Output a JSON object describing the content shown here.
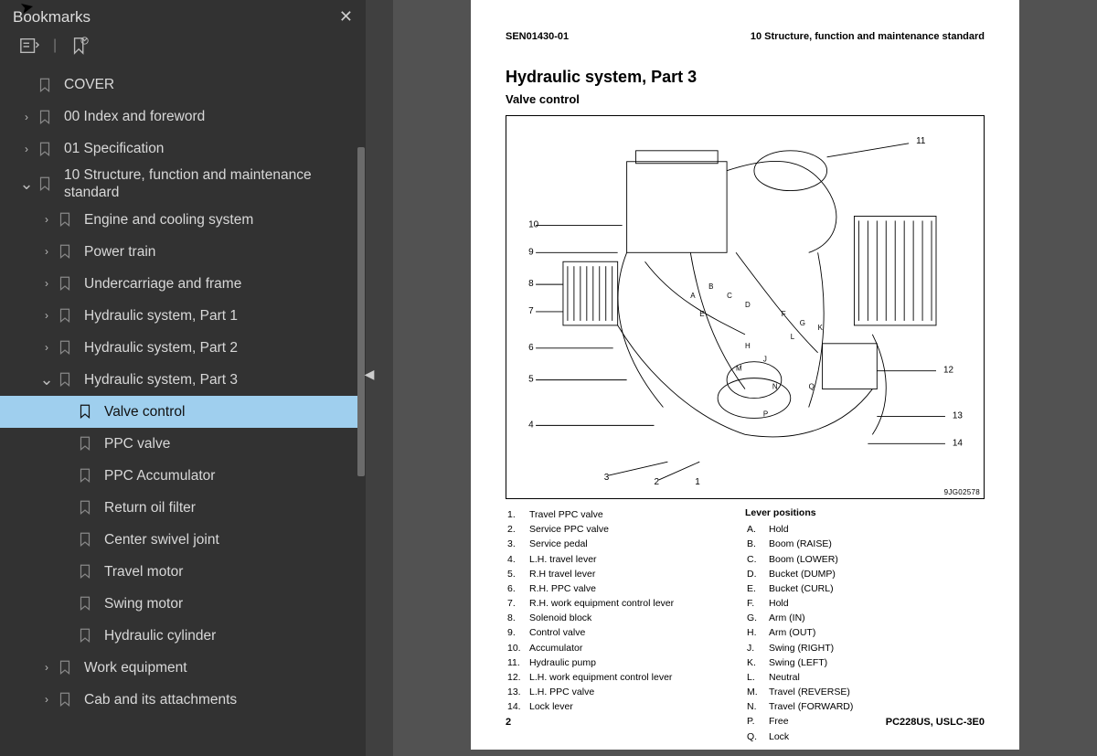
{
  "sidebar": {
    "title": "Bookmarks"
  },
  "tree": [
    {
      "label": "COVER",
      "expand": "",
      "depth": 0
    },
    {
      "label": "00 Index and foreword",
      "expand": ">",
      "depth": 0
    },
    {
      "label": "01 Specification",
      "expand": ">",
      "depth": 0
    },
    {
      "label": "10 Structure, function and maintenance standard",
      "expand": "v",
      "depth": 0
    },
    {
      "label": "Engine and cooling system",
      "expand": ">",
      "depth": 1
    },
    {
      "label": "Power train",
      "expand": ">",
      "depth": 1
    },
    {
      "label": "Undercarriage and frame",
      "expand": ">",
      "depth": 1
    },
    {
      "label": "Hydraulic system, Part 1",
      "expand": ">",
      "depth": 1
    },
    {
      "label": "Hydraulic system, Part 2",
      "expand": ">",
      "depth": 1
    },
    {
      "label": "Hydraulic system, Part 3",
      "expand": "v",
      "depth": 1
    },
    {
      "label": "Valve control",
      "expand": "",
      "depth": 2,
      "selected": true
    },
    {
      "label": "PPC valve",
      "expand": "",
      "depth": 2
    },
    {
      "label": "PPC Accumulator",
      "expand": "",
      "depth": 2
    },
    {
      "label": "Return oil filter",
      "expand": "",
      "depth": 2
    },
    {
      "label": "Center swivel joint",
      "expand": "",
      "depth": 2
    },
    {
      "label": "Travel motor",
      "expand": "",
      "depth": 2
    },
    {
      "label": "Swing motor",
      "expand": "",
      "depth": 2
    },
    {
      "label": "Hydraulic cylinder",
      "expand": "",
      "depth": 2
    },
    {
      "label": "Work equipment",
      "expand": ">",
      "depth": 1
    },
    {
      "label": "Cab and its attachments",
      "expand": ">",
      "depth": 1
    }
  ],
  "page": {
    "header_left": "SEN01430-01",
    "header_right": "10 Structure, function and maintenance standard",
    "title": "Hydraulic system, Part 3",
    "subtitle": "Valve control",
    "diagram_id": "9JG02578",
    "callouts_left": [
      "1",
      "2",
      "3",
      "4",
      "5",
      "6",
      "7",
      "8",
      "9",
      "10"
    ],
    "callouts_right": [
      "11",
      "12",
      "13",
      "14"
    ],
    "parts": [
      {
        "n": "1.",
        "t": "Travel PPC valve"
      },
      {
        "n": "2.",
        "t": "Service PPC valve"
      },
      {
        "n": "3.",
        "t": "Service pedal"
      },
      {
        "n": "4.",
        "t": "L.H. travel lever"
      },
      {
        "n": "5.",
        "t": "R.H travel lever"
      },
      {
        "n": "6.",
        "t": "R.H. PPC valve"
      },
      {
        "n": "7.",
        "t": "R.H. work equipment control lever"
      },
      {
        "n": "8.",
        "t": "Solenoid block"
      },
      {
        "n": "9.",
        "t": "Control valve"
      },
      {
        "n": "10.",
        "t": "Accumulator"
      },
      {
        "n": "11.",
        "t": "Hydraulic pump"
      },
      {
        "n": "12.",
        "t": "L.H. work equipment control lever"
      },
      {
        "n": "13.",
        "t": "L.H. PPC valve"
      },
      {
        "n": "14.",
        "t": "Lock lever"
      }
    ],
    "lever_heading": "Lever positions",
    "levers": [
      {
        "n": "A.",
        "t": "Hold"
      },
      {
        "n": "B.",
        "t": "Boom (RAISE)"
      },
      {
        "n": "C.",
        "t": "Boom (LOWER)"
      },
      {
        "n": "D.",
        "t": "Bucket (DUMP)"
      },
      {
        "n": "E.",
        "t": "Bucket (CURL)"
      },
      {
        "n": "F.",
        "t": "Hold"
      },
      {
        "n": "G.",
        "t": "Arm (IN)"
      },
      {
        "n": "H.",
        "t": "Arm (OUT)"
      },
      {
        "n": "J.",
        "t": "Swing (RIGHT)"
      },
      {
        "n": "K.",
        "t": "Swing (LEFT)"
      },
      {
        "n": "L.",
        "t": "Neutral"
      },
      {
        "n": "M.",
        "t": "Travel (REVERSE)"
      },
      {
        "n": "N.",
        "t": "Travel (FORWARD)"
      },
      {
        "n": "P.",
        "t": "Free"
      },
      {
        "n": "Q.",
        "t": "Lock"
      }
    ],
    "footer_left": "2",
    "footer_right": "PC228US, USLC-3E0"
  }
}
